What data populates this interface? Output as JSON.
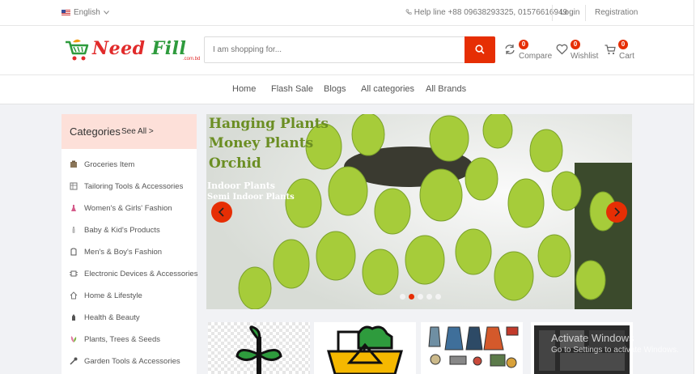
{
  "topbar": {
    "language": "English",
    "helpline": "Help line +88 09638293325, 01576616949",
    "login": "Login",
    "registration": "Registration"
  },
  "header": {
    "logo": "Need Fill",
    "logo_sub": ".com.bd",
    "search": {
      "placeholder": "I am shopping for..."
    },
    "compare": {
      "label": "Compare",
      "count": "0"
    },
    "wishlist": {
      "label": "Wishlist",
      "count": "0"
    },
    "cart": {
      "label": "Cart",
      "count": "0"
    }
  },
  "nav": [
    "Home",
    "Flash Sale",
    "Blogs",
    "All categories",
    "All Brands"
  ],
  "sidebar": {
    "title": "Categories",
    "see_all": "See All >",
    "items": [
      {
        "label": "Groceries Item",
        "icon": "groceries-icon"
      },
      {
        "label": "Tailoring Tools & Accessories",
        "icon": "tailoring-icon"
      },
      {
        "label": "Women's & Girls' Fashion",
        "icon": "dress-icon"
      },
      {
        "label": "Baby & Kid's Products",
        "icon": "baby-bottle-icon"
      },
      {
        "label": "Men's & Boy's Fashion",
        "icon": "shirt-icon"
      },
      {
        "label": "Electronic Devices & Accessories",
        "icon": "chip-icon"
      },
      {
        "label": "Home & Lifestyle",
        "icon": "house-icon"
      },
      {
        "label": "Health & Beauty",
        "icon": "beauty-icon"
      },
      {
        "label": "Plants, Trees & Seeds",
        "icon": "leaf-icon"
      },
      {
        "label": "Garden Tools & Accessories",
        "icon": "garden-tools-icon"
      }
    ]
  },
  "banner": {
    "line1": "Hanging Plants",
    "line2": "Money Plants",
    "line3": "Orchid",
    "line4": "Indoor Plants",
    "line5": "Semi Indoor Plants",
    "slides": 5,
    "active_slide": 2
  },
  "watermark": {
    "title": "Activate Windows",
    "subtitle": "Go to Settings to activate Windows."
  },
  "colors": {
    "accent": "#e62e04",
    "sidebar_head": "#fde0d9",
    "banner_text": "#6b8e23"
  }
}
